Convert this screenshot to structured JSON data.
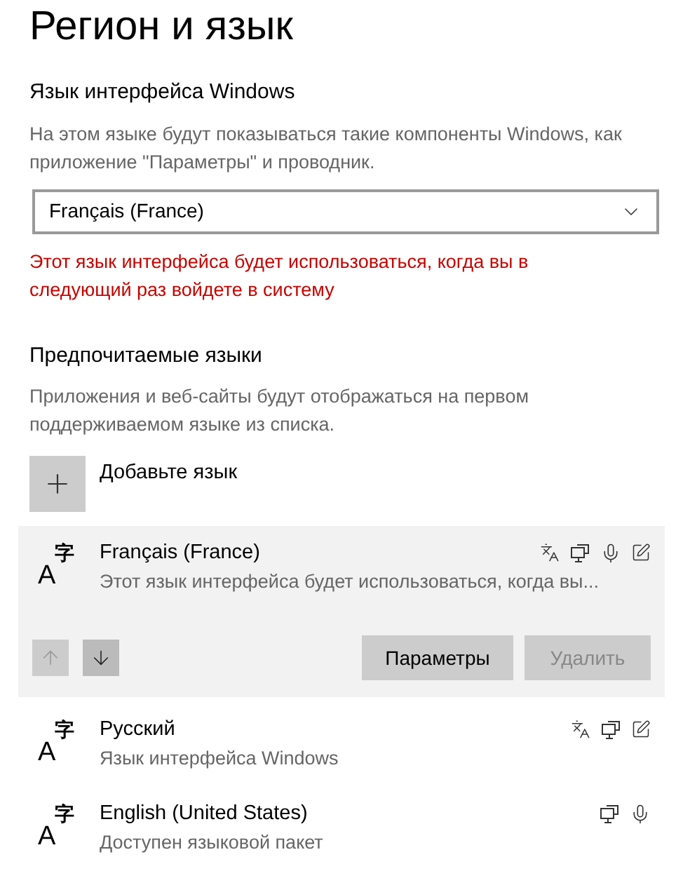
{
  "title": "Регион и язык",
  "display_language": {
    "heading": "Язык интерфейса Windows",
    "description": "На этом языке будут показываться такие компоненты Windows, как приложение \"Параметры\" и проводник.",
    "dropdown": {
      "value": "Français (France)"
    },
    "warning": "Этот язык интерфейса будет использоваться, когда вы в следующий раз войдете в систему"
  },
  "preferred": {
    "heading": "Предпочитаемые языки",
    "description": "Приложения и веб-сайты будут отображаться на первом поддерживаемом языке из списка.",
    "add_label": "Добавьте язык",
    "languages": [
      {
        "glyph_latin": "A",
        "glyph_cjk": "字",
        "name": "Français (France)",
        "status": "Этот язык интерфейса будет использоваться, когда вы...",
        "selected": true,
        "features": [
          {
            "kind": "display"
          },
          {
            "kind": "speech"
          },
          {
            "kind": "mic"
          },
          {
            "kind": "handwriting"
          }
        ],
        "move_up_disabled": true,
        "move_down_disabled": false,
        "options_label": "Параметры",
        "remove_label": "Удалить",
        "remove_disabled": true
      },
      {
        "glyph_latin": "A",
        "glyph_cjk": "字",
        "name": "Русский",
        "status": "Язык интерфейса Windows",
        "selected": false,
        "features": [
          {
            "kind": "display"
          },
          {
            "kind": "speech"
          },
          {
            "kind": "handwriting"
          }
        ]
      },
      {
        "glyph_latin": "A",
        "glyph_cjk": "字",
        "name": "English (United States)",
        "status": "Доступен языковой пакет",
        "selected": false,
        "features": [
          {
            "kind": "speech"
          },
          {
            "kind": "mic"
          }
        ]
      }
    ]
  }
}
